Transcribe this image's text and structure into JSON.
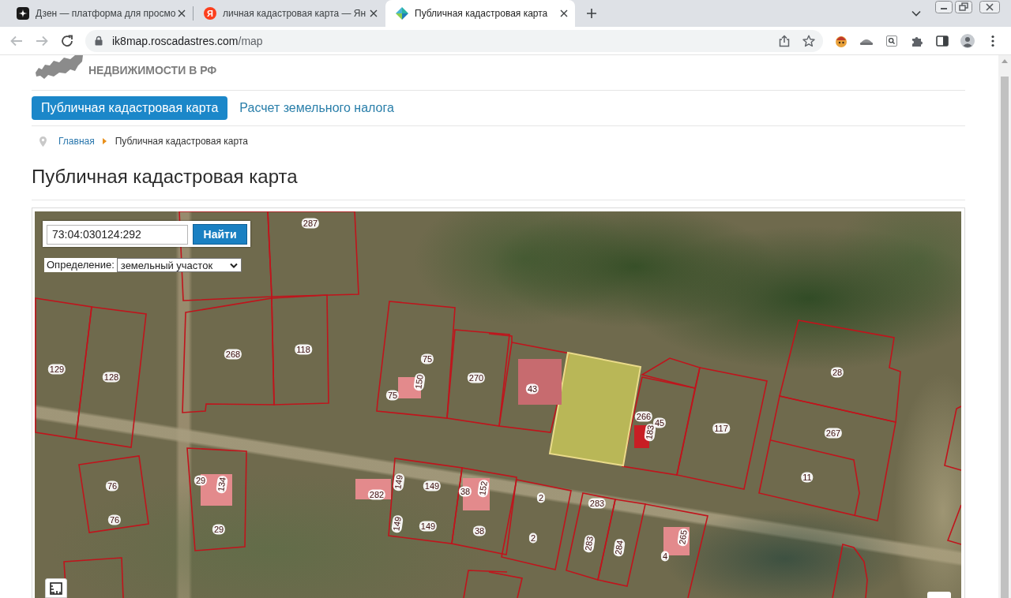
{
  "browser": {
    "tabs": [
      {
        "title": "Дзен — платформа для просмо",
        "kind": "sparkle",
        "selected": false
      },
      {
        "title": "личная кадастровая карта — Ян",
        "kind": "letter",
        "icon_text": "Я",
        "selected": false
      },
      {
        "title": "Публичная кадастровая карта",
        "kind": "pinwheel",
        "selected": true
      }
    ],
    "url": {
      "host": "ik8map.roscadastres.com",
      "path": "/map"
    }
  },
  "header": {
    "logo_text": "НЕДВИЖИМОСТИ В РФ"
  },
  "nav": [
    {
      "label": "Публичная кадастровая карта",
      "selected": true
    },
    {
      "label": "Расчет земельного налога",
      "selected": false
    }
  ],
  "breadcrumbs": [
    {
      "label": "Главная",
      "kind": "link"
    },
    {
      "label": "Публичная кадастровая карта",
      "kind": "current"
    }
  ],
  "page_title": "Публичная кадастровая карта",
  "map": {
    "search": {
      "value": "73:04:030124:292",
      "button": "Найти"
    },
    "definition": {
      "label": "Определение:",
      "value": "земельный участок"
    },
    "parcel_labels": [
      "287",
      "268",
      "118",
      "75",
      "28",
      "129",
      "128",
      "270",
      "150",
      "43",
      "75",
      "266",
      "45",
      "117",
      "183",
      "267",
      "11",
      "29",
      "134",
      "149",
      "76",
      "149",
      "38",
      "152",
      "282",
      "2",
      "283",
      "76",
      "149",
      "149",
      "29",
      "38",
      "2",
      "265",
      "283",
      "284",
      "4"
    ]
  }
}
